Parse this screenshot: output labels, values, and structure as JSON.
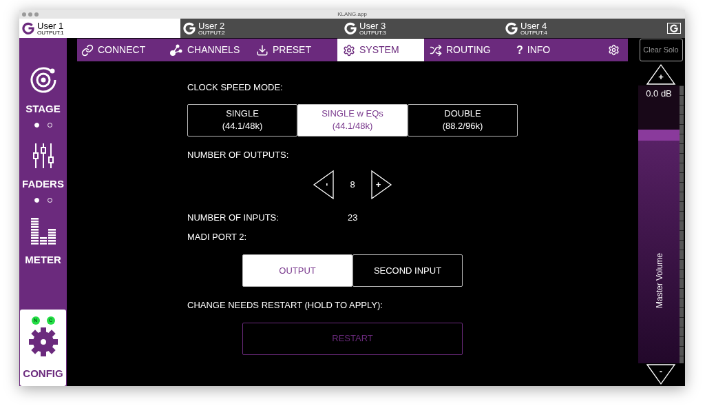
{
  "window": {
    "title": "KLANG.app"
  },
  "user_tabs": [
    {
      "name": "User 1",
      "output": "OUTPUT:1",
      "selected": true
    },
    {
      "name": "User 2",
      "output": "OUTPUT:2",
      "selected": false
    },
    {
      "name": "User 3",
      "output": "OUTPUT:3",
      "selected": false
    },
    {
      "name": "User 4",
      "output": "OUTPUT:4",
      "selected": false
    }
  ],
  "nav": [
    {
      "kind": "connect",
      "label": "CONNECT",
      "selected": false
    },
    {
      "kind": "channels",
      "label": "CHANNELS",
      "selected": false
    },
    {
      "kind": "preset",
      "label": "PRESET",
      "selected": false
    },
    {
      "kind": "system",
      "label": "SYSTEM",
      "selected": true
    },
    {
      "kind": "routing",
      "label": "ROUTING",
      "selected": false
    },
    {
      "kind": "info",
      "glyph": "?",
      "label": "INFO",
      "selected": false
    }
  ],
  "sidebar": [
    {
      "kind": "stage",
      "label": "STAGE",
      "selected": false,
      "pages": [
        {
          "selected": true
        },
        {
          "selected": false
        }
      ]
    },
    {
      "kind": "faders",
      "label": "FADERS",
      "selected": false,
      "pages": [
        {
          "selected": true
        },
        {
          "selected": false
        }
      ]
    },
    {
      "kind": "meter",
      "label": "METER",
      "selected": false
    },
    {
      "kind": "config",
      "label": "CONFIG",
      "selected": true,
      "leds": [
        {
          "label": "N",
          "on": true
        },
        {
          "label": "C",
          "on": true
        }
      ]
    }
  ],
  "system": {
    "clock_label": "CLOCK SPEED MODE:",
    "clock_modes": [
      {
        "label": "SINGLE",
        "rate": "(44.1/48k)",
        "selected": false
      },
      {
        "label": "SINGLE w EQs",
        "rate": "(44.1/48k)",
        "selected": true
      },
      {
        "label": "DOUBLE",
        "rate": "(88.2/96k)",
        "selected": false
      }
    ],
    "outputs_label": "NUMBER OF OUTPUTS:",
    "outputs_decrement": "-",
    "outputs_value": "8",
    "outputs_increment": "+",
    "inputs_label": "NUMBER OF INPUTS:",
    "inputs_value": "23",
    "madi_label": "MADI PORT 2:",
    "madi_modes": [
      {
        "label": "OUTPUT",
        "selected": true
      },
      {
        "label": "SECOND INPUT",
        "selected": false
      }
    ],
    "restart_label": "CHANGE NEEDS RESTART (HOLD TO APPLY):",
    "restart_button": {
      "label": "RESTART",
      "disabled": true
    }
  },
  "master": {
    "clear_solo": "Clear Solo",
    "up": "+",
    "reading": "0.0 dB",
    "level": 0.84,
    "label": "Master Volume",
    "down": "-"
  }
}
